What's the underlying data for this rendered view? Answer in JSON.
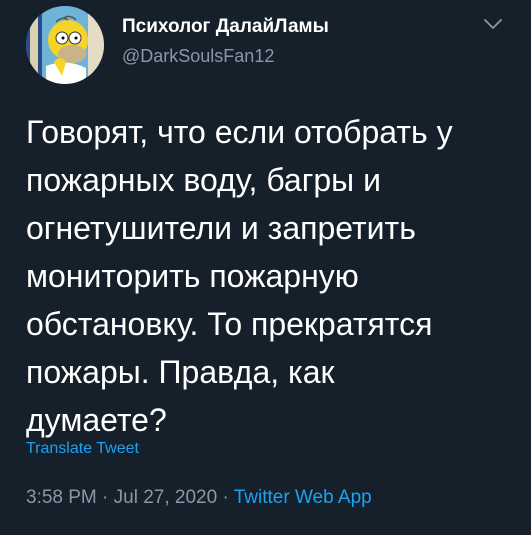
{
  "author": {
    "display_name": "Психолог ДалайЛамы",
    "handle": "@DarkSoulsFan12",
    "avatar_icon": "homer-avatar-icon"
  },
  "tweet": {
    "lines": [
      "Говорят, что если отобрать у",
      "пожарных воду, багры и",
      "огнетушители и запретить",
      "мониторить пожарную",
      "обстановку. То прекратятся",
      "пожары. Правда, как",
      "думаете?"
    ],
    "translate_label": "Translate Tweet"
  },
  "meta": {
    "time": "3:58 PM",
    "separator": "·",
    "date": "Jul 27, 2020",
    "source": "Twitter Web App"
  },
  "menu": {
    "icon": "chevron-down-icon"
  },
  "colors": {
    "background": "#15202b",
    "text": "#ffffff",
    "secondary": "#8899a6",
    "accent": "#1da1f2"
  }
}
